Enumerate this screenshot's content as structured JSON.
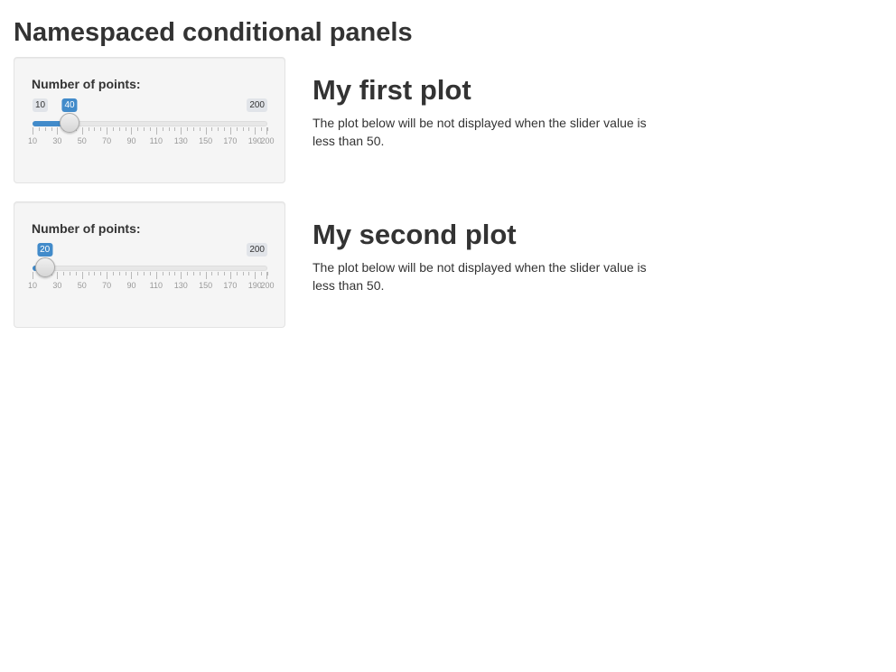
{
  "page": {
    "title": "Namespaced conditional panels"
  },
  "modules": [
    {
      "slider": {
        "label": "Number of points:",
        "min": 10,
        "max": 200,
        "value": 40,
        "min_label": "10",
        "max_label": "200",
        "value_label": "40",
        "tick_labels": [
          "10",
          "30",
          "50",
          "70",
          "90",
          "110",
          "130",
          "150",
          "170",
          "190",
          "200"
        ]
      },
      "plot": {
        "title": "My first plot",
        "description": "The plot below will be not displayed when the slider value is less than 50."
      }
    },
    {
      "slider": {
        "label": "Number of points:",
        "min": 10,
        "max": 200,
        "value": 20,
        "min_label": "10",
        "max_label": "200",
        "value_label": "20",
        "tick_labels": [
          "10",
          "30",
          "50",
          "70",
          "90",
          "110",
          "130",
          "150",
          "170",
          "190",
          "200"
        ]
      },
      "plot": {
        "title": "My second plot",
        "description": "The plot below will be not displayed when the slider value is less than 50."
      }
    }
  ],
  "colors": {
    "accent": "#428bca",
    "well_bg": "#f5f5f5",
    "text": "#333333"
  }
}
